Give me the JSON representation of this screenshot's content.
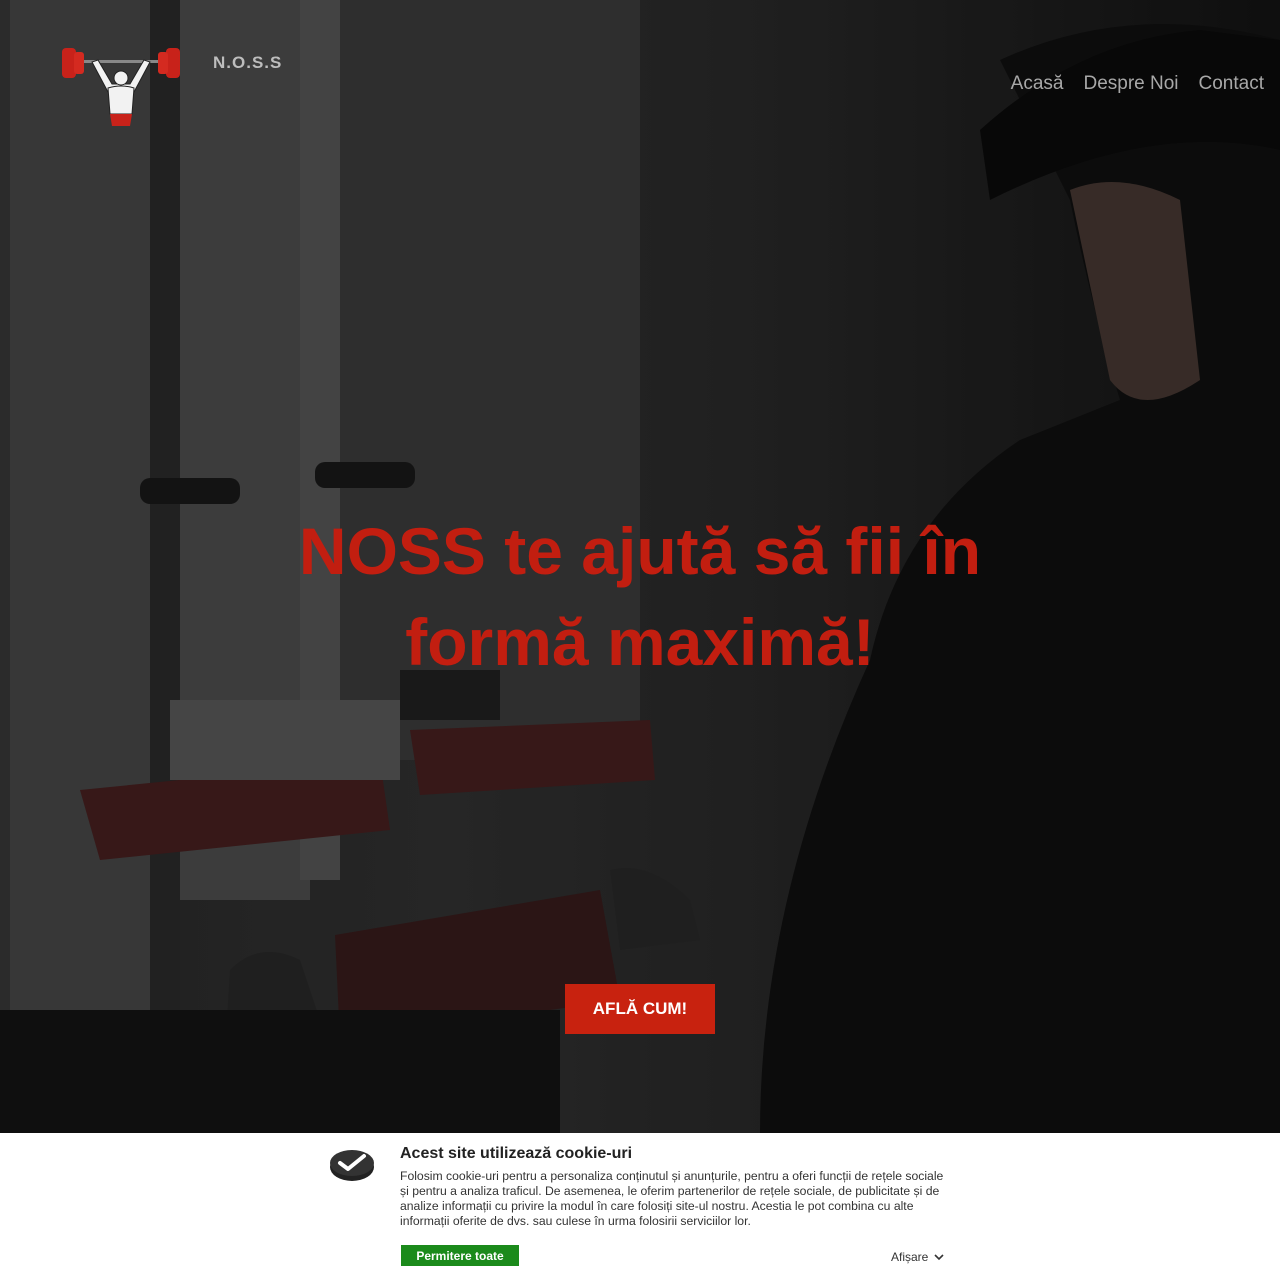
{
  "header": {
    "brand": "N.O.S.S",
    "nav": [
      "Acasă",
      "Despre Noi",
      "Contact"
    ]
  },
  "hero": {
    "headline": "NOSS te ajută să fii în formă maximă!",
    "cta_label": "AFLĂ CUM!"
  },
  "cookie": {
    "title": "Acest site utilizează cookie-uri",
    "text": "Folosim cookie-uri pentru a personaliza conținutul și anunțurile, pentru a oferi funcții de rețele sociale și pentru a analiza traficul. De asemenea, le oferim partenerilor de rețele sociale, de publicitate și de analize informații cu privire la modul în care folosiți site-ul nostru. Acestia le pot combina cu alte informații oferite de dvs. sau culese în urma folosirii serviciilor lor.",
    "allow_label": "Permitere toate",
    "show_label": "Afișare"
  },
  "colors": {
    "accent_red": "#c8220f",
    "allow_green": "#1b8a1b"
  }
}
